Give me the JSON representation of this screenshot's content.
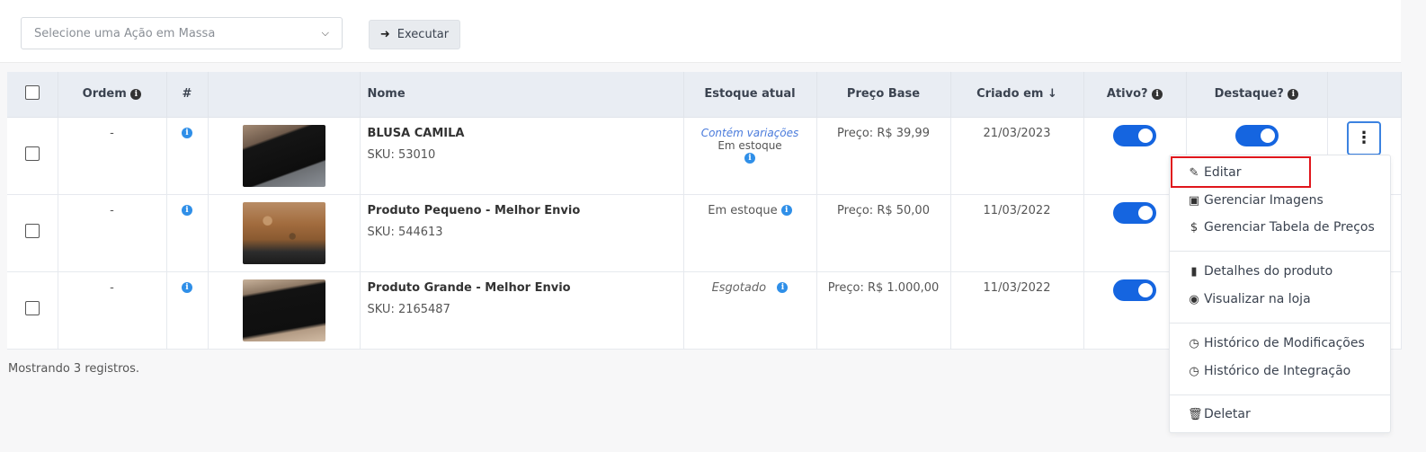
{
  "toolbar": {
    "mass_action_placeholder": "Selecione uma Ação em Massa",
    "execute_label": "Executar"
  },
  "table": {
    "headers": {
      "ordem": "Ordem",
      "hash": "#",
      "nome": "Nome",
      "estoque": "Estoque atual",
      "preco": "Preço Base",
      "criado": "Criado em",
      "criado_sort": "↓",
      "ativo": "Ativo?",
      "destaque": "Destaque?"
    },
    "rows": [
      {
        "ordem": "-",
        "name": "BLUSA CAMILA",
        "sku": "SKU: 53010",
        "stock_variation": "Contém variações",
        "stock_status": "Em estoque",
        "price": "Preço: R$ 39,99",
        "created": "21/03/2023",
        "active": true,
        "featured": true
      },
      {
        "ordem": "-",
        "name": "Produto Pequeno - Melhor Envio",
        "sku": "SKU: 544613",
        "stock_status": "Em estoque",
        "price": "Preço: R$ 50,00",
        "created": "11/03/2022",
        "active": true
      },
      {
        "ordem": "-",
        "name": "Produto Grande - Melhor Envio",
        "sku": "SKU: 2165487",
        "stock_status": "Esgotado",
        "price": "Preço: R$ 1.000,00",
        "created": "11/03/2022",
        "active": true
      }
    ]
  },
  "footer": {
    "records": "Mostrando 3 registros."
  },
  "context_menu": {
    "items": [
      {
        "label": "Editar",
        "icon": "pencil-icon"
      },
      {
        "label": "Gerenciar Imagens",
        "icon": "image-icon"
      },
      {
        "label": "Gerenciar Tabela de Preços",
        "icon": "dollar-icon"
      },
      {
        "label": "Detalhes do produto",
        "icon": "book-icon"
      },
      {
        "label": "Visualizar na loja",
        "icon": "eye-icon"
      },
      {
        "label": "Histórico de Modificações",
        "icon": "clock-icon"
      },
      {
        "label": "Histórico de Integração",
        "icon": "clock-icon"
      },
      {
        "label": "Deletar",
        "icon": "trash-icon"
      }
    ]
  },
  "colors": {
    "toggle_on": "#1565e0",
    "info": "#2f8fe8",
    "highlight": "#e0161c",
    "header_bg": "#e9edf3"
  }
}
